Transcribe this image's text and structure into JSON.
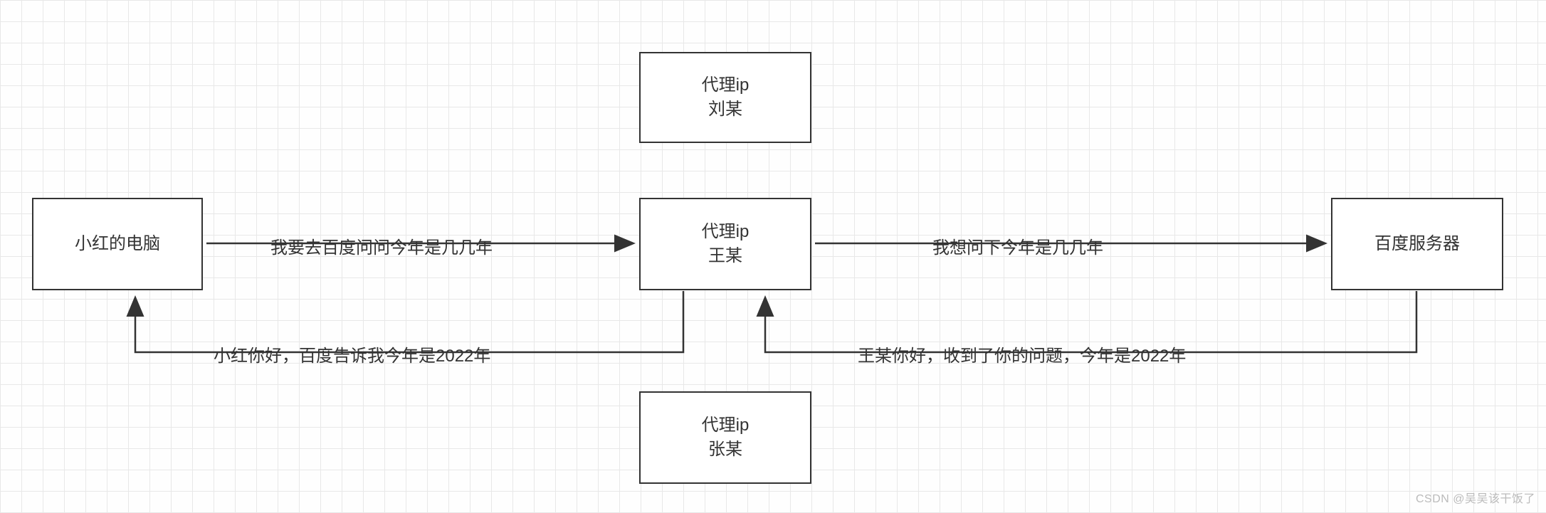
{
  "nodes": {
    "client": "小红的电脑",
    "proxy_top_line1": "代理ip",
    "proxy_top_line2": "刘某",
    "proxy_mid_line1": "代理ip",
    "proxy_mid_line2": "王某",
    "proxy_bot_line1": "代理ip",
    "proxy_bot_line2": "张某",
    "server": "百度服务器"
  },
  "edges": {
    "req1": "我要去百度问问今年是几几年",
    "resp1": "小红你好，百度告诉我今年是2022年",
    "req2": "我想问下今年是几几年",
    "resp2": "王某你好，收到了你的问题，今年是2022年"
  },
  "watermark": "CSDN @吴吴该干饭了"
}
